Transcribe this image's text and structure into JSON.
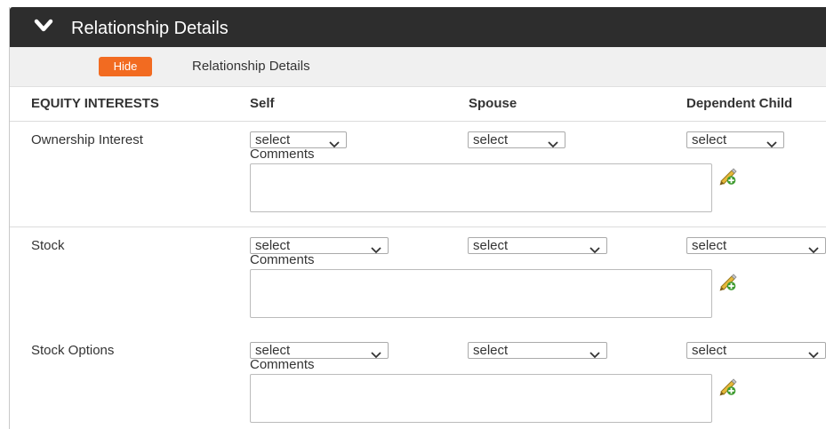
{
  "header": {
    "title": "Relationship Details"
  },
  "subbar": {
    "hide_label": "Hide",
    "section_label": "Relationship Details"
  },
  "columns": [
    "EQUITY INTERESTS",
    "Self",
    "Spouse",
    "Dependent Child"
  ],
  "rows": [
    {
      "label": "Ownership Interest",
      "self": "select",
      "spouse": "select",
      "child": "select",
      "comments_label": "Comments",
      "comments_value": ""
    },
    {
      "label": "Stock",
      "self": "select",
      "spouse": "select",
      "child": "select",
      "comments_label": "Comments",
      "comments_value": ""
    },
    {
      "label": "Stock Options",
      "self": "select",
      "spouse": "select",
      "child": "select",
      "comments_label": "Comments",
      "comments_value": ""
    }
  ],
  "icons": {
    "header_toggle": "chevron-down-icon",
    "select_arrow": "chevron-down-icon",
    "edit": "pencil-edit-icon"
  },
  "colors": {
    "header_bg": "#2d2d2d",
    "hide_button": "#f26b21",
    "subbar_bg": "#f0f0f0",
    "edit_icon_pencil": "#e6b93a",
    "edit_icon_plus": "#3c9a2e"
  }
}
